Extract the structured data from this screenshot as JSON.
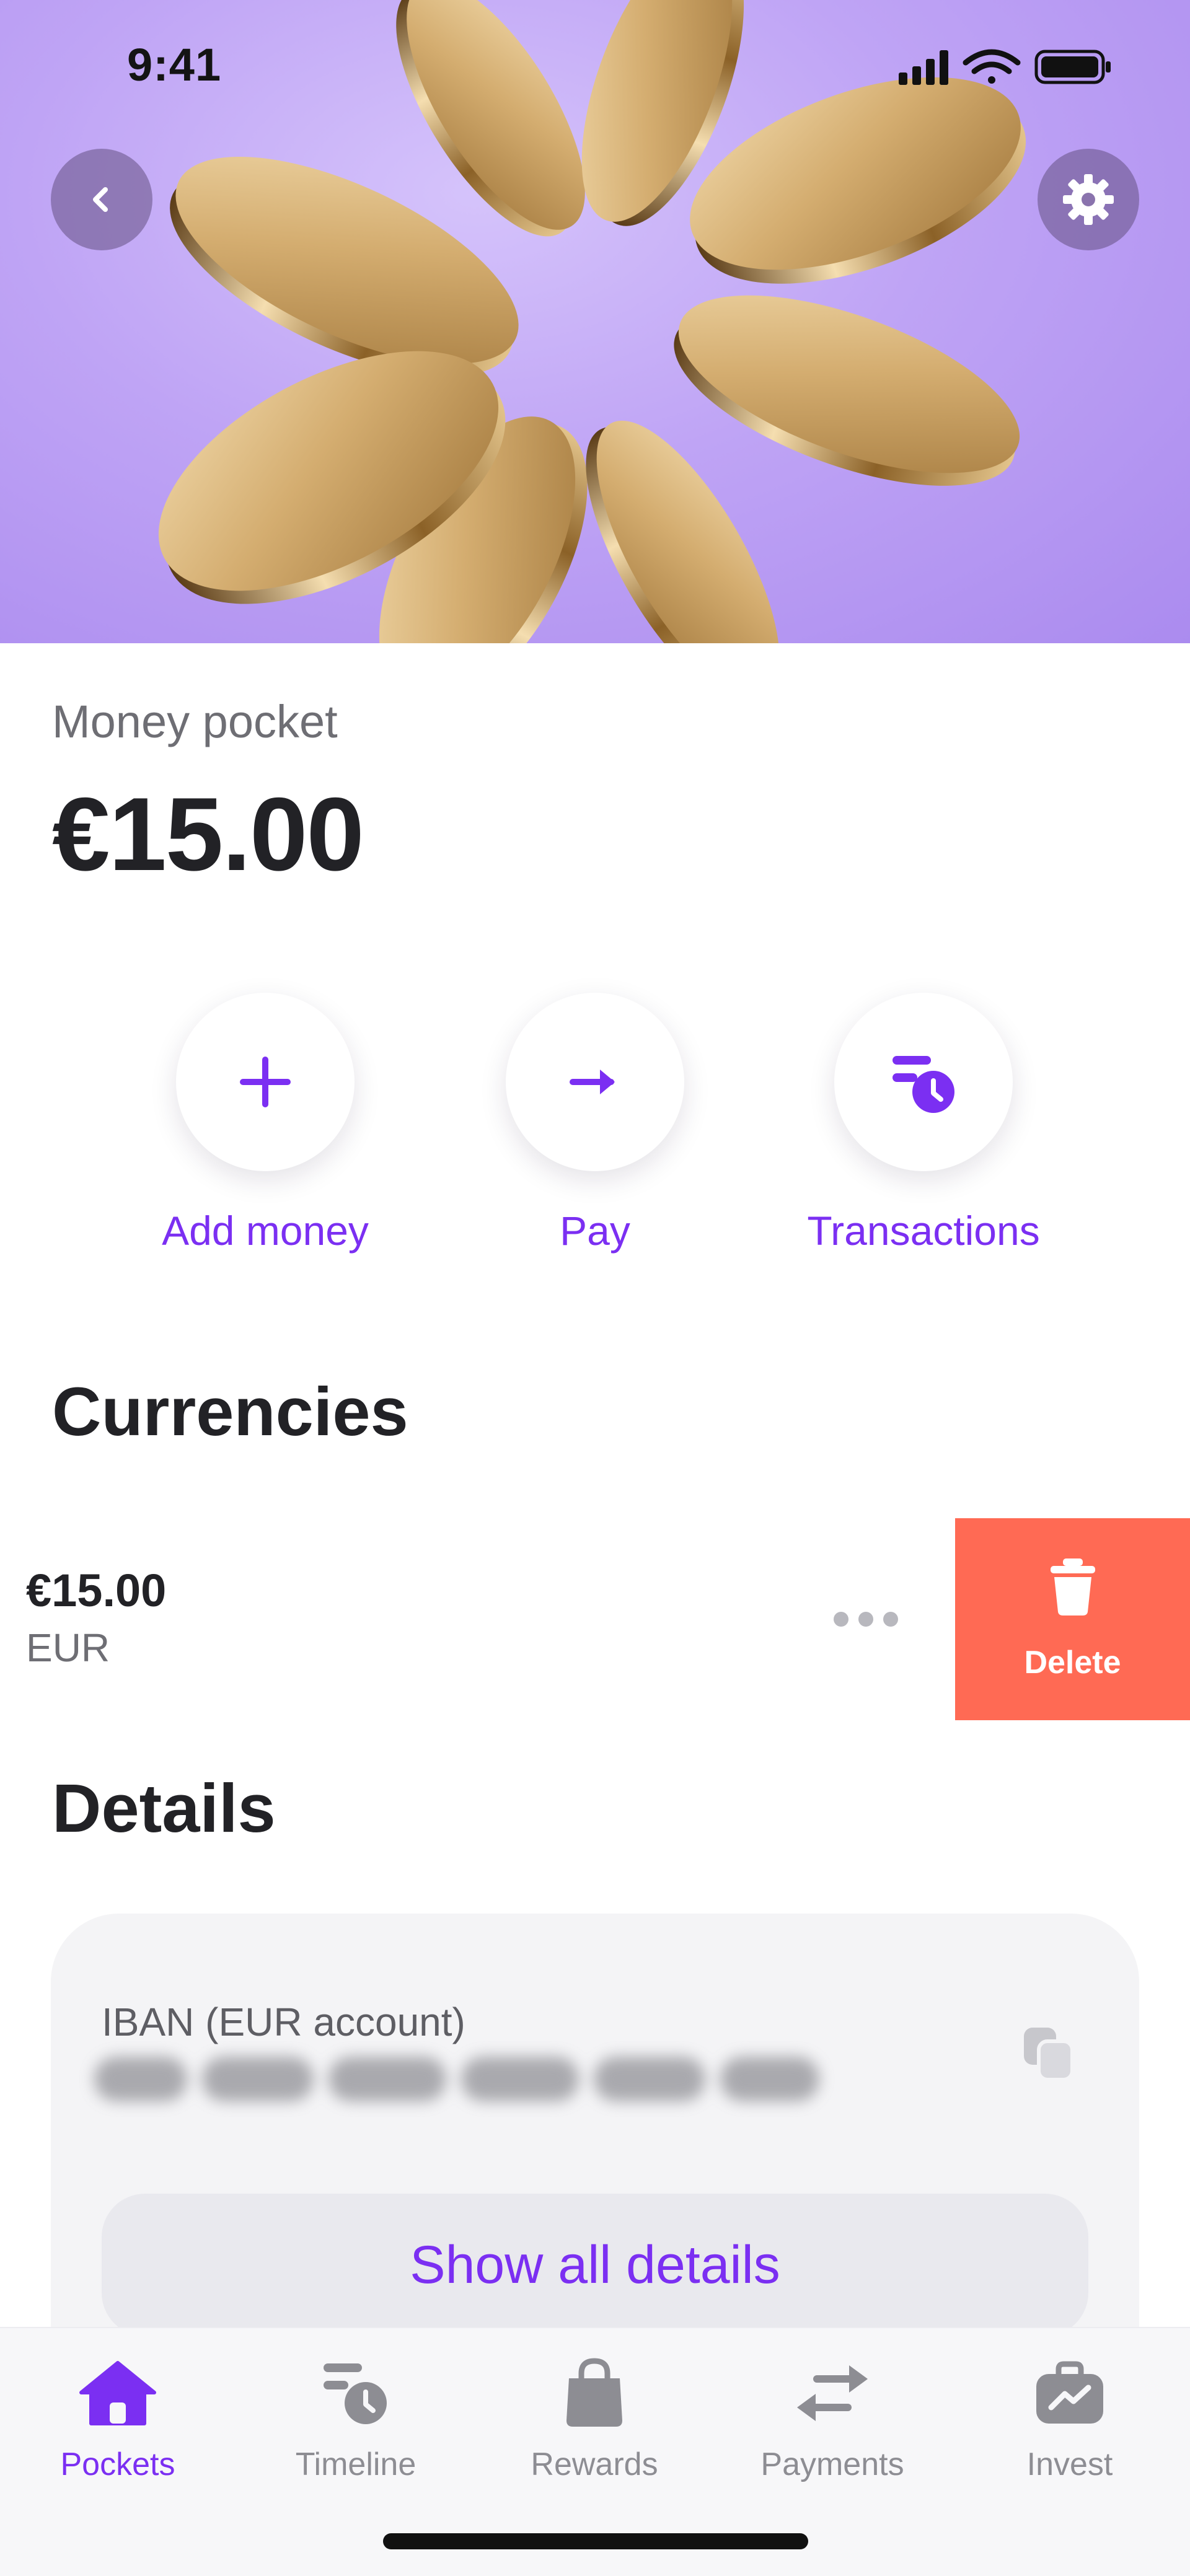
{
  "status_bar": {
    "time": "9:41"
  },
  "pocket": {
    "label": "Money pocket",
    "balance": "€15.00"
  },
  "actions": [
    {
      "label": "Add money",
      "icon": "plus-icon"
    },
    {
      "label": "Pay",
      "icon": "arrow-right-icon"
    },
    {
      "label": "Transactions",
      "icon": "transactions-clock-icon"
    }
  ],
  "currencies": {
    "title": "Currencies",
    "items": [
      {
        "amount": "€15.00",
        "code": "EUR"
      }
    ],
    "delete_label": "Delete"
  },
  "details": {
    "title": "Details",
    "iban_label": "IBAN (EUR account)",
    "show_all_label": "Show all details"
  },
  "tabs": [
    {
      "label": "Pockets",
      "icon": "home-icon",
      "active": true
    },
    {
      "label": "Timeline",
      "icon": "timeline-clock-icon",
      "active": false
    },
    {
      "label": "Rewards",
      "icon": "shopping-bag-icon",
      "active": false
    },
    {
      "label": "Payments",
      "icon": "transfer-arrows-icon",
      "active": false
    },
    {
      "label": "Invest",
      "icon": "briefcase-chart-icon",
      "active": false
    }
  ],
  "colors": {
    "accent": "#7b2ff2",
    "hero_bg": "#bfa4f5",
    "delete_bg": "#ff6a54",
    "coin_gold": "#c9a264"
  }
}
